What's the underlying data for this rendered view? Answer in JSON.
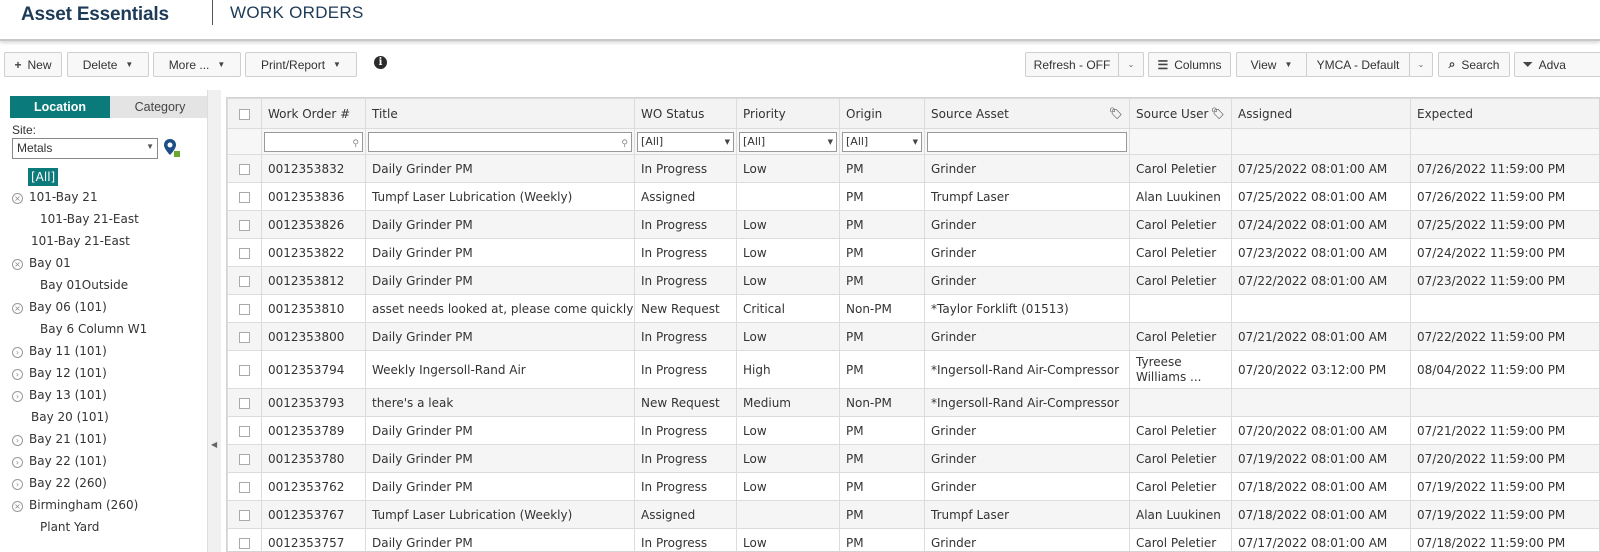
{
  "header": {
    "brand": "Asset Essentials",
    "page_title": "WORK ORDERS"
  },
  "toolbar": {
    "new_label": "New",
    "delete_label": "Delete",
    "more_label": "More ...",
    "print_label": "Print/Report",
    "refresh_label": "Refresh - OFF",
    "columns_label": "Columns",
    "view_label": "View",
    "view_select": "YMCA - Default",
    "search_label": "Search",
    "advanced_label": "Adva"
  },
  "left": {
    "tabs": {
      "location": "Location",
      "category": "Category"
    },
    "site_label": "Site:",
    "site_value": "Metals",
    "all_label": "[All]",
    "tree": [
      {
        "label": "101-Bay 21",
        "indent": 0,
        "toggle": "x"
      },
      {
        "label": "101-Bay 21-East",
        "indent": 1,
        "toggle": ""
      },
      {
        "label": "101-Bay 21-East",
        "indent": 0,
        "toggle": ""
      },
      {
        "label": "Bay 01",
        "indent": 0,
        "toggle": "x"
      },
      {
        "label": "Bay 01Outside",
        "indent": 1,
        "toggle": ""
      },
      {
        "label": "Bay 06 (101)",
        "indent": 0,
        "toggle": "x"
      },
      {
        "label": "Bay 6 Column W1",
        "indent": 1,
        "toggle": ""
      },
      {
        "label": "Bay 11 (101)",
        "indent": 0,
        "toggle": ">"
      },
      {
        "label": "Bay 12 (101)",
        "indent": 0,
        "toggle": ">"
      },
      {
        "label": "Bay 13 (101)",
        "indent": 0,
        "toggle": ">"
      },
      {
        "label": "Bay 20 (101)",
        "indent": 0,
        "toggle": ""
      },
      {
        "label": "Bay 21 (101)",
        "indent": 0,
        "toggle": ">"
      },
      {
        "label": "Bay 22 (101)",
        "indent": 0,
        "toggle": ">"
      },
      {
        "label": "Bay 22 (260)",
        "indent": 0,
        "toggle": ">"
      },
      {
        "label": "Birmingham (260)",
        "indent": 0,
        "toggle": "x"
      },
      {
        "label": "Plant Yard",
        "indent": 1,
        "toggle": ""
      }
    ]
  },
  "grid": {
    "columns": [
      "Work Order #",
      "Title",
      "WO Status",
      "Priority",
      "Origin",
      "Source Asset",
      "Source User",
      "Assigned",
      "Expected"
    ],
    "filters": {
      "status": "[All]",
      "priority": "[All]",
      "origin": "[All]"
    },
    "rows": [
      {
        "wo": "0012353832",
        "title": "Daily Grinder PM",
        "status": "In Progress",
        "priority": "Low",
        "origin": "PM",
        "asset": "Grinder",
        "user": "Carol Peletier",
        "assigned": "07/25/2022 08:01:00 AM",
        "expected": "07/26/2022 11:59:00 PM"
      },
      {
        "wo": "0012353836",
        "title": "Tumpf Laser Lubrication (Weekly)",
        "status": "Assigned",
        "priority": "",
        "origin": "PM",
        "asset": "Trumpf Laser",
        "user": "Alan Luukinen",
        "assigned": "07/25/2022 08:01:00 AM",
        "expected": "07/26/2022 11:59:00 PM"
      },
      {
        "wo": "0012353826",
        "title": "Daily Grinder PM",
        "status": "In Progress",
        "priority": "Low",
        "origin": "PM",
        "asset": "Grinder",
        "user": "Carol Peletier",
        "assigned": "07/24/2022 08:01:00 AM",
        "expected": "07/25/2022 11:59:00 PM"
      },
      {
        "wo": "0012353822",
        "title": "Daily Grinder PM",
        "status": "In Progress",
        "priority": "Low",
        "origin": "PM",
        "asset": "Grinder",
        "user": "Carol Peletier",
        "assigned": "07/23/2022 08:01:00 AM",
        "expected": "07/24/2022 11:59:00 PM"
      },
      {
        "wo": "0012353812",
        "title": "Daily Grinder PM",
        "status": "In Progress",
        "priority": "Low",
        "origin": "PM",
        "asset": "Grinder",
        "user": "Carol Peletier",
        "assigned": "07/22/2022 08:01:00 AM",
        "expected": "07/23/2022 11:59:00 PM"
      },
      {
        "wo": "0012353810",
        "title": "asset needs looked at, please come quickly",
        "status": "New Request",
        "priority": "Critical",
        "origin": "Non-PM",
        "asset": "*Taylor Forklift (01513)",
        "user": "",
        "assigned": "",
        "expected": ""
      },
      {
        "wo": "0012353800",
        "title": "Daily Grinder PM",
        "status": "In Progress",
        "priority": "Low",
        "origin": "PM",
        "asset": "Grinder",
        "user": "Carol Peletier",
        "assigned": "07/21/2022 08:01:00 AM",
        "expected": "07/22/2022 11:59:00 PM"
      },
      {
        "wo": "0012353794",
        "title": "Weekly Ingersoll-Rand Air",
        "status": "In Progress",
        "priority": "High",
        "origin": "PM",
        "asset": "*Ingersoll-Rand Air-Compressor",
        "user": "Tyreese Williams ...",
        "assigned": "07/20/2022 03:12:00 PM",
        "expected": "08/04/2022 11:59:00 PM"
      },
      {
        "wo": "0012353793",
        "title": "there's a leak",
        "status": "New Request",
        "priority": "Medium",
        "origin": "Non-PM",
        "asset": "*Ingersoll-Rand Air-Compressor",
        "user": "",
        "assigned": "",
        "expected": ""
      },
      {
        "wo": "0012353789",
        "title": "Daily Grinder PM",
        "status": "In Progress",
        "priority": "Low",
        "origin": "PM",
        "asset": "Grinder",
        "user": "Carol Peletier",
        "assigned": "07/20/2022 08:01:00 AM",
        "expected": "07/21/2022 11:59:00 PM"
      },
      {
        "wo": "0012353780",
        "title": "Daily Grinder PM",
        "status": "In Progress",
        "priority": "Low",
        "origin": "PM",
        "asset": "Grinder",
        "user": "Carol Peletier",
        "assigned": "07/19/2022 08:01:00 AM",
        "expected": "07/20/2022 11:59:00 PM"
      },
      {
        "wo": "0012353762",
        "title": "Daily Grinder PM",
        "status": "In Progress",
        "priority": "Low",
        "origin": "PM",
        "asset": "Grinder",
        "user": "Carol Peletier",
        "assigned": "07/18/2022 08:01:00 AM",
        "expected": "07/19/2022 11:59:00 PM"
      },
      {
        "wo": "0012353767",
        "title": "Tumpf Laser Lubrication (Weekly)",
        "status": "Assigned",
        "priority": "",
        "origin": "PM",
        "asset": "Trumpf Laser",
        "user": "Alan Luukinen",
        "assigned": "07/18/2022 08:01:00 AM",
        "expected": "07/19/2022 11:59:00 PM"
      },
      {
        "wo": "0012353757",
        "title": "Daily Grinder PM",
        "status": "In Progress",
        "priority": "Low",
        "origin": "PM",
        "asset": "Grinder",
        "user": "Carol Peletier",
        "assigned": "07/17/2022 08:01:00 AM",
        "expected": "07/18/2022 11:59:00 PM"
      }
    ]
  }
}
